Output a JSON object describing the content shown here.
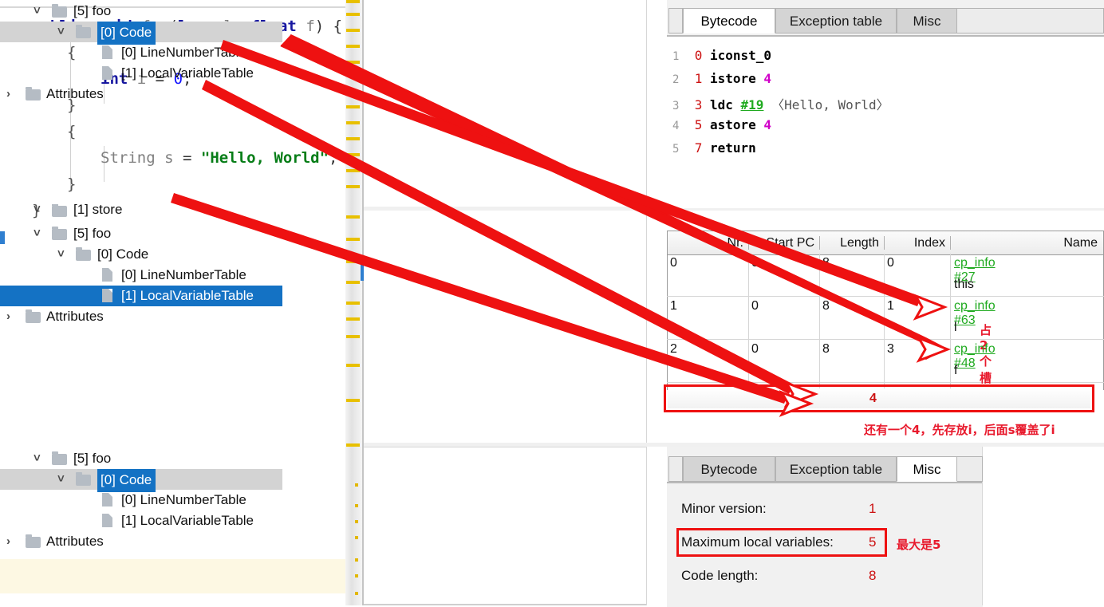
{
  "editor": {
    "lines": [
      {
        "id": "l1",
        "text": "public void foo(long l, float f) {"
      },
      {
        "id": "l2",
        "text": "{"
      },
      {
        "id": "l3",
        "text": "int i = 0;"
      },
      {
        "id": "l4",
        "text": "}"
      },
      {
        "id": "l5",
        "text": "{"
      },
      {
        "id": "l6",
        "text": "String s = \"Hello, World\";"
      },
      {
        "id": "l7",
        "text": "}"
      },
      {
        "id": "l8",
        "text": "}"
      }
    ],
    "tokens": {
      "public": "public",
      "void": "void",
      "foo": "foo",
      "long": "long",
      "l": "l",
      "float": "float",
      "f": "f",
      "int": "int",
      "i": "i",
      "zero": "0",
      "String": "String",
      "s": "s",
      "hello": "\"Hello, World\""
    }
  },
  "tree1": {
    "rows": [
      {
        "label": "[5] foo",
        "type": "folder",
        "depth": 1,
        "state": "expanded",
        "selected": "none"
      },
      {
        "label": "[0] Code",
        "type": "folder",
        "depth": 2,
        "state": "expanded",
        "selected": "grey-blue"
      },
      {
        "label": "[0] LineNumberTable",
        "type": "file",
        "depth": 3,
        "state": "leaf",
        "selected": "none"
      },
      {
        "label": "[1] LocalVariableTable",
        "type": "file",
        "depth": 3,
        "state": "leaf",
        "selected": "none"
      },
      {
        "label": "Attributes",
        "type": "folder",
        "depth": 0,
        "state": "collapsed",
        "selected": "none"
      }
    ]
  },
  "tree2": {
    "rows": [
      {
        "label": "[1] store",
        "type": "folder",
        "depth": 1,
        "state": "expanded",
        "selected": "none"
      },
      {
        "label": "[5] foo",
        "type": "folder",
        "depth": 1,
        "state": "expanded",
        "selected": "none"
      },
      {
        "label": "[0] Code",
        "type": "folder",
        "depth": 2,
        "state": "expanded",
        "selected": "none"
      },
      {
        "label": "[0] LineNumberTable",
        "type": "file",
        "depth": 3,
        "state": "leaf",
        "selected": "none"
      },
      {
        "label": "[1] LocalVariableTable",
        "type": "file",
        "depth": 3,
        "state": "leaf",
        "selected": "blue"
      },
      {
        "label": "Attributes",
        "type": "folder",
        "depth": 0,
        "state": "collapsed",
        "selected": "none"
      }
    ]
  },
  "tree3": {
    "rows": [
      {
        "label": "[5] foo",
        "type": "folder",
        "depth": 1,
        "state": "expanded",
        "selected": "none"
      },
      {
        "label": "[0] Code",
        "type": "folder",
        "depth": 2,
        "state": "expanded",
        "selected": "grey-blue"
      },
      {
        "label": "[0] LineNumberTable",
        "type": "file",
        "depth": 3,
        "state": "leaf",
        "selected": "none"
      },
      {
        "label": "[1] LocalVariableTable",
        "type": "file",
        "depth": 3,
        "state": "leaf",
        "selected": "none"
      },
      {
        "label": "Attributes",
        "type": "folder",
        "depth": 0,
        "state": "collapsed",
        "selected": "none"
      }
    ]
  },
  "bytecode_panel": {
    "tabs": [
      {
        "label": "Bytecode",
        "active": true
      },
      {
        "label": "Exception table",
        "active": false
      },
      {
        "label": "Misc",
        "active": false
      }
    ],
    "instructions": [
      {
        "line": "1",
        "pc": "0",
        "op": "iconst_0",
        "arg": "",
        "ref": "",
        "comment": ""
      },
      {
        "line": "2",
        "pc": "1",
        "op": "istore",
        "arg": "4",
        "ref": "",
        "comment": ""
      },
      {
        "line": "3",
        "pc": "3",
        "op": "ldc",
        "arg": "",
        "ref": "#19",
        "comment": "〈Hello, World〉"
      },
      {
        "line": "4",
        "pc": "5",
        "op": "astore",
        "arg": "4",
        "ref": "",
        "comment": ""
      },
      {
        "line": "5",
        "pc": "7",
        "op": "return",
        "arg": "",
        "ref": "",
        "comment": ""
      }
    ]
  },
  "lvt": {
    "columns": [
      "Nr.",
      "Start PC",
      "Length",
      "Index",
      "Name"
    ],
    "rows": [
      {
        "nr": "0",
        "start_pc": "0",
        "length": "8",
        "index": "0",
        "name_ref": "cp_info #27",
        "name_value": "this",
        "note": ""
      },
      {
        "nr": "1",
        "start_pc": "0",
        "length": "8",
        "index": "1",
        "name_ref": "cp_info #63",
        "name_value": "l",
        "note": "占2个槽位"
      },
      {
        "nr": "2",
        "start_pc": "0",
        "length": "8",
        "index": "3",
        "name_ref": "cp_info #48",
        "name_value": "f",
        "note": ""
      }
    ],
    "highlighted_row_value": "4",
    "highlight_note": "还有一个4，先存放i，后面s覆盖了i"
  },
  "misc_panel": {
    "tabs": [
      {
        "label": "Bytecode",
        "active": false
      },
      {
        "label": "Exception table",
        "active": false
      },
      {
        "label": "Misc",
        "active": true
      }
    ],
    "fields": [
      {
        "label": "Minor version:",
        "value": "1"
      },
      {
        "label": "Maximum local variables:",
        "value": "5"
      },
      {
        "label": "Code length:",
        "value": "8"
      }
    ],
    "highlight_note": "最大是5"
  },
  "colors": {
    "annotation_red": "#ee1111",
    "selection_blue": "#1472c4",
    "selection_grey": "#d3d3d3",
    "link_green": "#1faa1f",
    "marker_yellow": "#e8c000"
  }
}
